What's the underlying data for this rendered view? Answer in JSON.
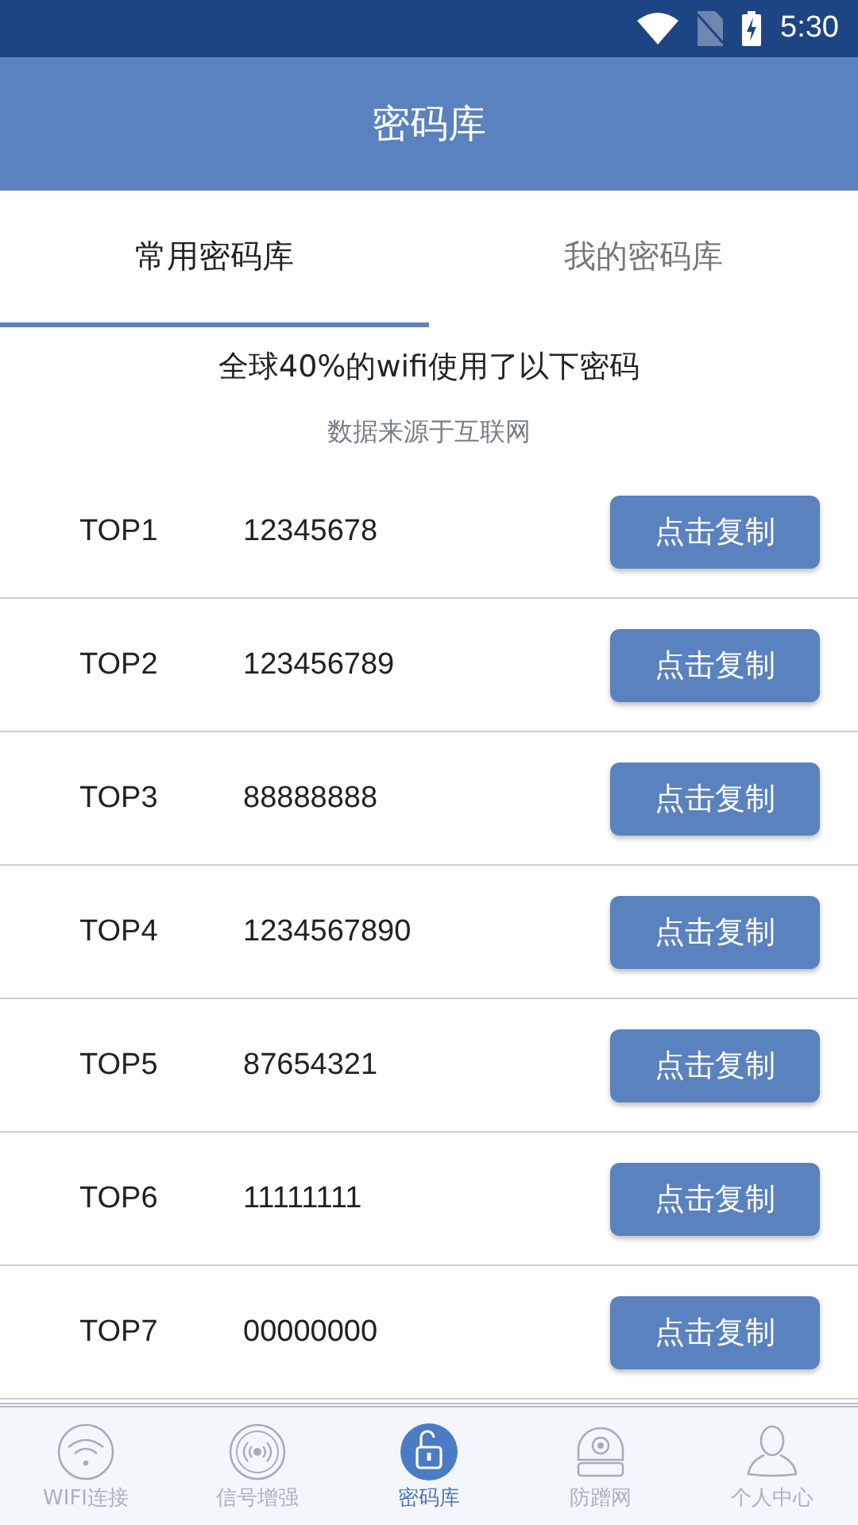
{
  "status_bar": {
    "time": "5:30"
  },
  "header": {
    "title": "密码库"
  },
  "tabs": [
    {
      "label": "常用密码库",
      "selected": true
    },
    {
      "label": "我的密码库",
      "selected": false
    }
  ],
  "intro": {
    "heading": "全球40%的wifi使用了以下密码",
    "source": "数据来源于互联网"
  },
  "passwords": [
    {
      "rank": "TOP1",
      "password": "12345678",
      "button": "点击复制"
    },
    {
      "rank": "TOP2",
      "password": "123456789",
      "button": "点击复制"
    },
    {
      "rank": "TOP3",
      "password": "88888888",
      "button": "点击复制"
    },
    {
      "rank": "TOP4",
      "password": "1234567890",
      "button": "点击复制"
    },
    {
      "rank": "TOP5",
      "password": "87654321",
      "button": "点击复制"
    },
    {
      "rank": "TOP6",
      "password": "11111111",
      "button": "点击复制"
    },
    {
      "rank": "TOP7",
      "password": "00000000",
      "button": "点击复制"
    }
  ],
  "bottom_nav": [
    {
      "label": "WIFI连接",
      "kind": "wifi",
      "selected": false
    },
    {
      "label": "信号增强",
      "kind": "signal",
      "selected": false
    },
    {
      "label": "密码库",
      "kind": "lock",
      "selected": true
    },
    {
      "label": "防蹭网",
      "kind": "camera",
      "selected": false
    },
    {
      "label": "个人中心",
      "kind": "person",
      "selected": false
    }
  ]
}
